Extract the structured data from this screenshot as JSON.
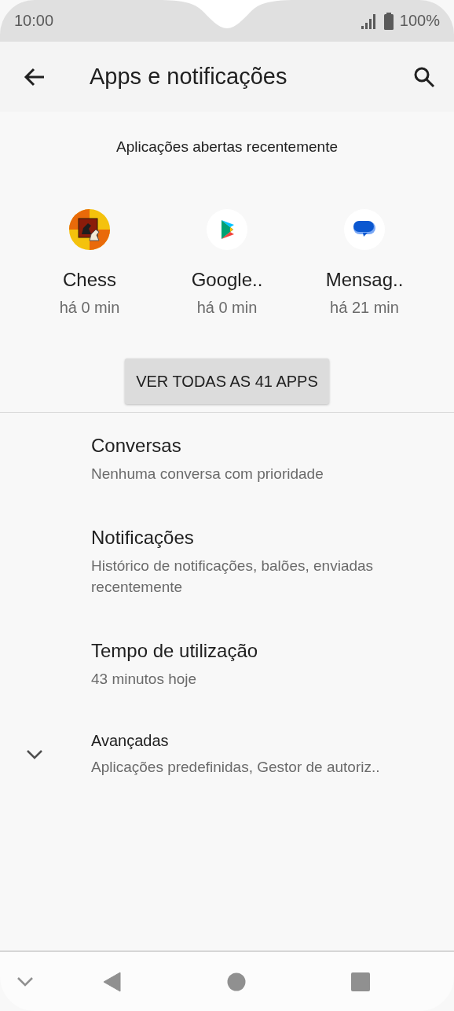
{
  "status_bar": {
    "time": "10:00",
    "battery": "100%"
  },
  "toolbar": {
    "title": "Apps e notificações"
  },
  "recent": {
    "heading": "Aplicações abertas recentemente",
    "apps": [
      {
        "kind": "chess",
        "name": "Chess",
        "time": "há 0 min"
      },
      {
        "kind": "play",
        "name": "Google..",
        "time": "há 0 min"
      },
      {
        "kind": "messages",
        "name": "Mensag..",
        "time": "há 21 min"
      }
    ],
    "button": "VER TODAS AS 41 APPS"
  },
  "items": [
    {
      "kind": "plain",
      "title": "Conversas",
      "subtitle": "Nenhuma conversa com prioridade"
    },
    {
      "kind": "plain",
      "title": "Notificações",
      "subtitle": "Histórico de notificações, balões, enviadas recentemente"
    },
    {
      "kind": "plain",
      "title": "Tempo de utilização",
      "subtitle": "43 minutos hoje"
    },
    {
      "kind": "expandable",
      "expanded": false,
      "title": "Avançadas",
      "subtitle": "Aplicações predefinidas, Gestor de autoriz.."
    }
  ]
}
